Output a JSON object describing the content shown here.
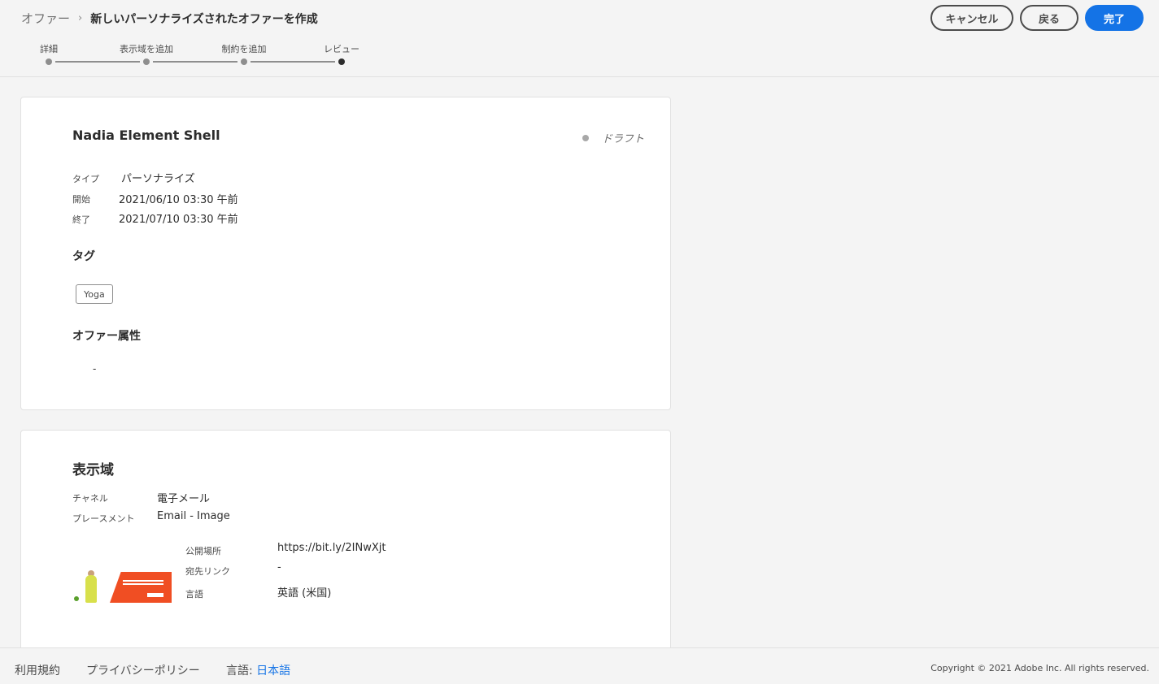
{
  "breadcrumb": {
    "root": "オファー",
    "separator": "›",
    "current": "新しいパーソナライズされたオファーを作成"
  },
  "actions": {
    "cancel": "キャンセル",
    "back": "戻る",
    "done": "完了"
  },
  "stepper": {
    "steps": [
      {
        "label": "詳細",
        "active": false
      },
      {
        "label": "表示域を追加",
        "active": false
      },
      {
        "label": "制約を追加",
        "active": false
      },
      {
        "label": "レビュー",
        "active": true
      }
    ]
  },
  "offer": {
    "name": "Nadia Element Shell",
    "status": "ドラフト",
    "fields": [
      {
        "label": "タイプ",
        "value": "パーソナライズ"
      },
      {
        "label": "開始",
        "value": "2021/06/10 03:30 午前"
      },
      {
        "label": "終了",
        "value": "2021/07/10 03:30 午前"
      }
    ],
    "tags_title": "タグ",
    "tags": [
      "Yoga"
    ],
    "attributes_title": "オファー属性",
    "attributes_value": "-"
  },
  "representation": {
    "title": "表示域",
    "channel_label": "チャネル",
    "channel_value": "電子メール",
    "placement_label": "プレースメント",
    "placement_value": "Email - Image",
    "asset": {
      "public_location_label": "公開場所",
      "public_location_value": "https://bit.ly/2INwXjt",
      "destination_link_label": "宛先リンク",
      "destination_link_value": "-",
      "language_label": "言語",
      "language_value": "英語 (米国)"
    }
  },
  "footer": {
    "terms": "利用規約",
    "privacy": "プライバシーポリシー",
    "language_prefix": "言語:",
    "language_value": "日本語",
    "copyright": "Copyright ©  2021 Adobe Inc.  All rights reserved."
  },
  "colors": {
    "accent": "#1473e6",
    "background": "#f4f4f4",
    "card": "#ffffff"
  }
}
